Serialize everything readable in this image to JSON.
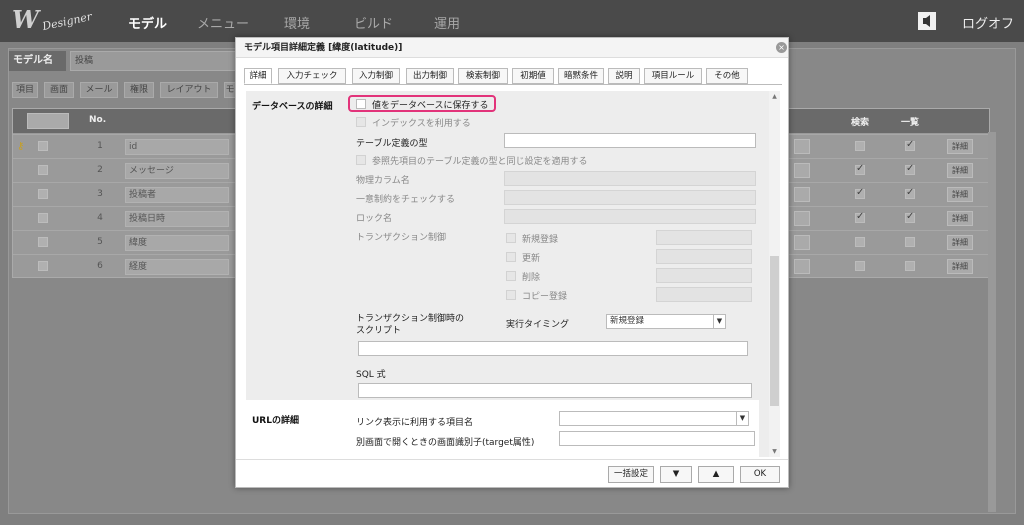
{
  "header": {
    "logo_mark": "W",
    "logo_script": "Designer",
    "nav": [
      "モデル",
      "メニュー",
      "環境",
      "ビルド",
      "運用"
    ],
    "logout": "ログオフ"
  },
  "background": {
    "model_label": "モデル名",
    "model_value": "投稿",
    "tabs": [
      "項目",
      "画面",
      "メール",
      "権限",
      "レイアウト",
      "モ"
    ],
    "table_headers": {
      "no": "No.",
      "search": "検索",
      "list": "一覧"
    },
    "rows": [
      {
        "no": "1",
        "name": "id",
        "search": false,
        "list": true,
        "key": true
      },
      {
        "no": "2",
        "name": "メッセージ",
        "search": true,
        "list": true,
        "key": false
      },
      {
        "no": "3",
        "name": "投稿者",
        "search": true,
        "list": true,
        "key": false
      },
      {
        "no": "4",
        "name": "投稿日時",
        "search": true,
        "list": true,
        "key": false
      },
      {
        "no": "5",
        "name": "緯度",
        "search": false,
        "list": false,
        "key": false
      },
      {
        "no": "6",
        "name": "経度",
        "search": false,
        "list": false,
        "key": false
      }
    ],
    "detail_label": "詳細"
  },
  "dialog": {
    "title": "モデル項目詳細定義 [緯度(latitude)]",
    "tabs": [
      "詳細",
      "入力チェック",
      "入力制御",
      "出力制御",
      "検索制御",
      "初期値",
      "暗黙条件",
      "説明",
      "項目ルール",
      "その他"
    ],
    "db_section": {
      "title": "データベースの詳細",
      "save_to_db": "値をデータベースに保存する",
      "use_index": "インデックスを利用する",
      "table_type": "テーブル定義の型",
      "apply_ref": "参照先項目のテーブル定義の型と同じ設定を適用する",
      "physical_column": "物理カラム名",
      "unique_check": "一意制約をチェックする",
      "lock_name": "ロック名",
      "transaction": "トランザクション制御",
      "tx_options": [
        "新規登録",
        "更新",
        "削除",
        "コピー登録"
      ],
      "tx_script_line1": "トランザクション制御時の",
      "tx_script_line2": "スクリプト",
      "exec_timing": "実行タイミング",
      "exec_timing_value": "新規登録",
      "sql": "SQL 式"
    },
    "url_section": {
      "title": "URLの詳細",
      "link_item": "リンク表示に利用する項目名",
      "target": "別画面で開くときの画面識別子(target属性)"
    },
    "footer": {
      "batch": "一括設定",
      "down": "▼",
      "up": "▲",
      "ok": "OK"
    }
  }
}
